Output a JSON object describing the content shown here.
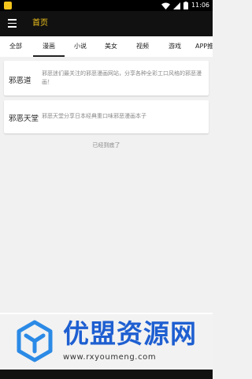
{
  "status": {
    "time": "11:06",
    "icons": [
      "wifi-icon",
      "signal-icon",
      "battery-icon"
    ]
  },
  "appbar": {
    "title": "首页",
    "menu_icon": "menu-icon",
    "title_color": "#f3c51c"
  },
  "tabs": [
    {
      "label": "全部",
      "active": false
    },
    {
      "label": "漫画",
      "active": true
    },
    {
      "label": "小说",
      "active": false
    },
    {
      "label": "美女",
      "active": false
    },
    {
      "label": "视频",
      "active": false
    },
    {
      "label": "游戏",
      "active": false
    },
    {
      "label": "APP推",
      "active": false
    }
  ],
  "items": [
    {
      "name": "邪恶道",
      "desc": "邪恶迷们最关注的邪恶漫画网站，分享各种全彩工口风格的邪恶漫画！"
    },
    {
      "name": "邪恶天堂",
      "desc": "邪恶天堂分享日本经典重口味邪恶漫画本子"
    }
  ],
  "end_text": "已经到底了",
  "watermark": {
    "title": "优盟资源网",
    "url": "www.rxyoumeng.com",
    "brand_color": "#1e5fd1"
  }
}
